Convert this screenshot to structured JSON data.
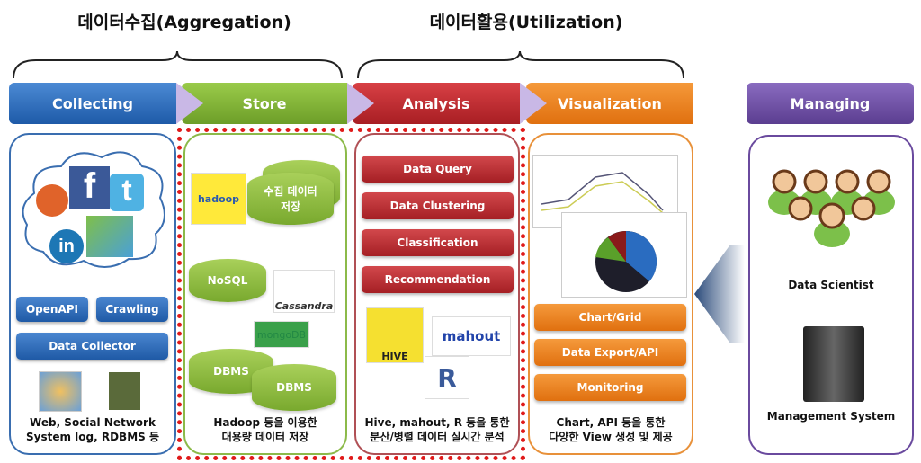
{
  "titles": {
    "aggregation": "데이터수집(Aggregation)",
    "utilization": "데이터활용(Utilization)"
  },
  "stages": [
    {
      "label": "Collecting",
      "color": "#2a68b8"
    },
    {
      "label": "Store",
      "color": "#7cad33"
    },
    {
      "label": "Analysis",
      "color": "#c0282d"
    },
    {
      "label": "Visualization",
      "color": "#ec7d1a"
    },
    {
      "label": "Managing",
      "color": "#6a4a9e"
    }
  ],
  "collecting": {
    "buttons": [
      "OpenAPI",
      "Crawling",
      "Data Collector"
    ],
    "icons": [
      "rss-icon",
      "facebook-icon",
      "twitter-icon",
      "linkedin-icon",
      "maps-icon",
      "flume-icon",
      "crawler-icon"
    ],
    "caption": [
      "Web, Social Network",
      "System log, RDBMS 등"
    ]
  },
  "store": {
    "cylinders": [
      "수집 데이터 저장",
      "NoSQL",
      "DBMS",
      "DBMS"
    ],
    "logos": [
      "hadoop",
      "Cassandra",
      "mongoDB"
    ],
    "caption": [
      "Hadoop 등을 이용한",
      "대용량 데이터 저장"
    ]
  },
  "analysis": {
    "buttons": [
      "Data Query",
      "Data Clustering",
      "Classification",
      "Recommendation"
    ],
    "logos": [
      "HIVE",
      "mahout",
      "R"
    ],
    "caption": [
      "Hive, mahout, R 등을 통한",
      "분산/병렬 데이터 실시간 분석"
    ]
  },
  "visualization": {
    "buttons": [
      "Chart/Grid",
      "Data Export/API",
      "Monitoring"
    ],
    "caption": [
      "Chart, API 등을 통한",
      "다양한 View 생성 및 제공"
    ]
  },
  "managing": {
    "items": [
      "Data Scientist",
      "Management System"
    ]
  }
}
